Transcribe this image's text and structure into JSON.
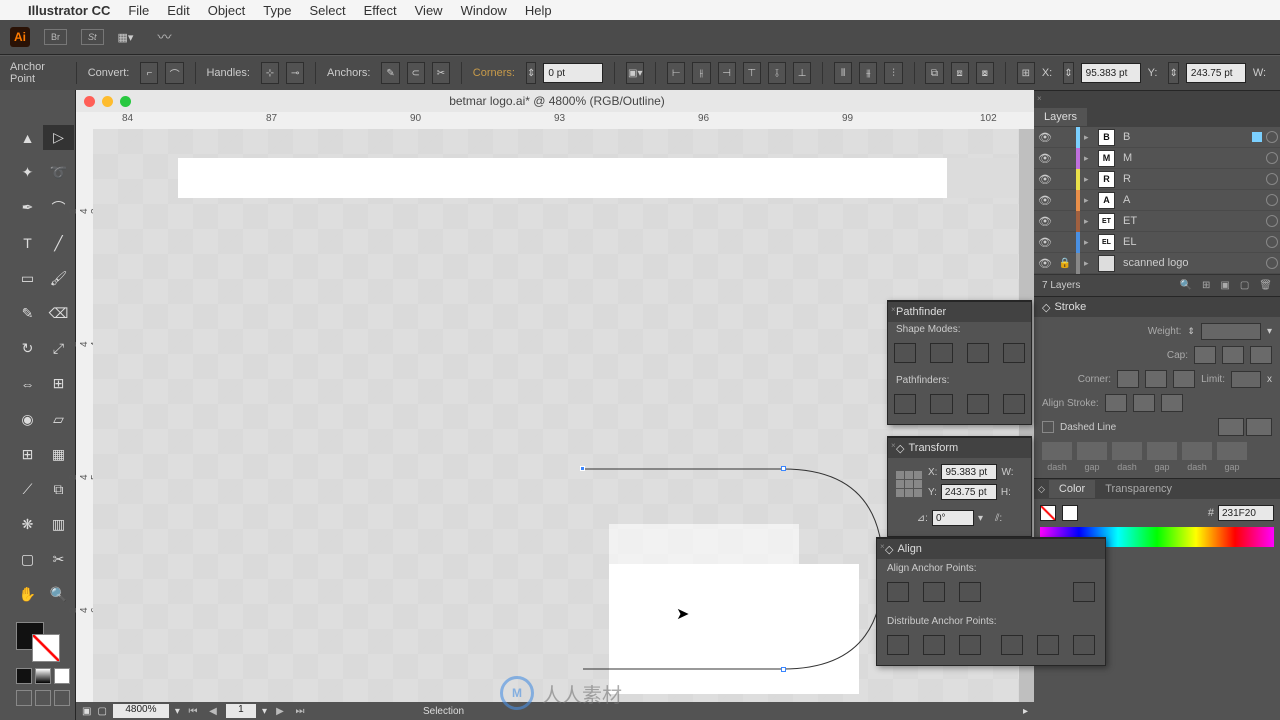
{
  "menubar": {
    "app": "Illustrator CC",
    "items": [
      "File",
      "Edit",
      "Object",
      "Type",
      "Select",
      "Effect",
      "View",
      "Window",
      "Help"
    ]
  },
  "control": {
    "tool_label": "Anchor Point",
    "convert": "Convert:",
    "handles": "Handles:",
    "anchors": "Anchors:",
    "corners": "Corners:",
    "corner_val": "0 pt",
    "x_label": "X:",
    "x_val": "95.383 pt",
    "y_label": "Y:",
    "y_val": "243.75 pt",
    "w_label": "W:"
  },
  "document": {
    "title": "betmar logo.ai* @ 4800% (RGB/Outline)",
    "ruler_marks": [
      "84",
      "87",
      "90",
      "93",
      "96",
      "99",
      "102"
    ],
    "ruler_left_1": "2\n4\n3",
    "ruler_left_2": "2\n4\n4",
    "ruler_left_3": "2\n4\n5",
    "ruler_left_4": "2\n4\n6",
    "zoom": "4800%",
    "page": "1",
    "status": "Selection"
  },
  "layers": {
    "title": "Layers",
    "count": "7 Layers",
    "rows": [
      {
        "name": "B",
        "color": "#7bd0ff",
        "thumb": "B"
      },
      {
        "name": "M",
        "color": "#c070dd",
        "thumb": "M"
      },
      {
        "name": "R",
        "color": "#e9e04a",
        "thumb": "R"
      },
      {
        "name": "A",
        "color": "#e98f4a",
        "thumb": "A"
      },
      {
        "name": "ET",
        "color": "#a06040",
        "thumb": "ET"
      },
      {
        "name": "EL",
        "color": "#4a90e2",
        "thumb": "EL"
      },
      {
        "name": "scanned logo",
        "color": "#888",
        "thumb": "",
        "locked": true
      }
    ]
  },
  "stroke": {
    "title": "Stroke",
    "weight": "Weight:",
    "cap": "Cap:",
    "corner": "Corner:",
    "limit": "Limit:",
    "limit_x": "x",
    "align": "Align Stroke:",
    "dashed": "Dashed Line",
    "dash": "dash",
    "gap": "gap"
  },
  "color": {
    "tab1": "Color",
    "tab2": "Transparency",
    "hash": "#",
    "hex": "231F20"
  },
  "pathfinder": {
    "title": "Pathfinder",
    "shape_modes": "Shape Modes:",
    "pathfinders": "Pathfinders:"
  },
  "transform": {
    "title": "Transform",
    "x": "X:",
    "y": "Y:",
    "w": "W:",
    "h": "H:",
    "x_val": "95.383 pt",
    "y_val": "243.75 pt",
    "angle": "0°"
  },
  "align": {
    "title": "Align",
    "anchor": "Align Anchor Points:",
    "distribute": "Distribute Anchor Points:"
  },
  "watermark": "人人素材"
}
